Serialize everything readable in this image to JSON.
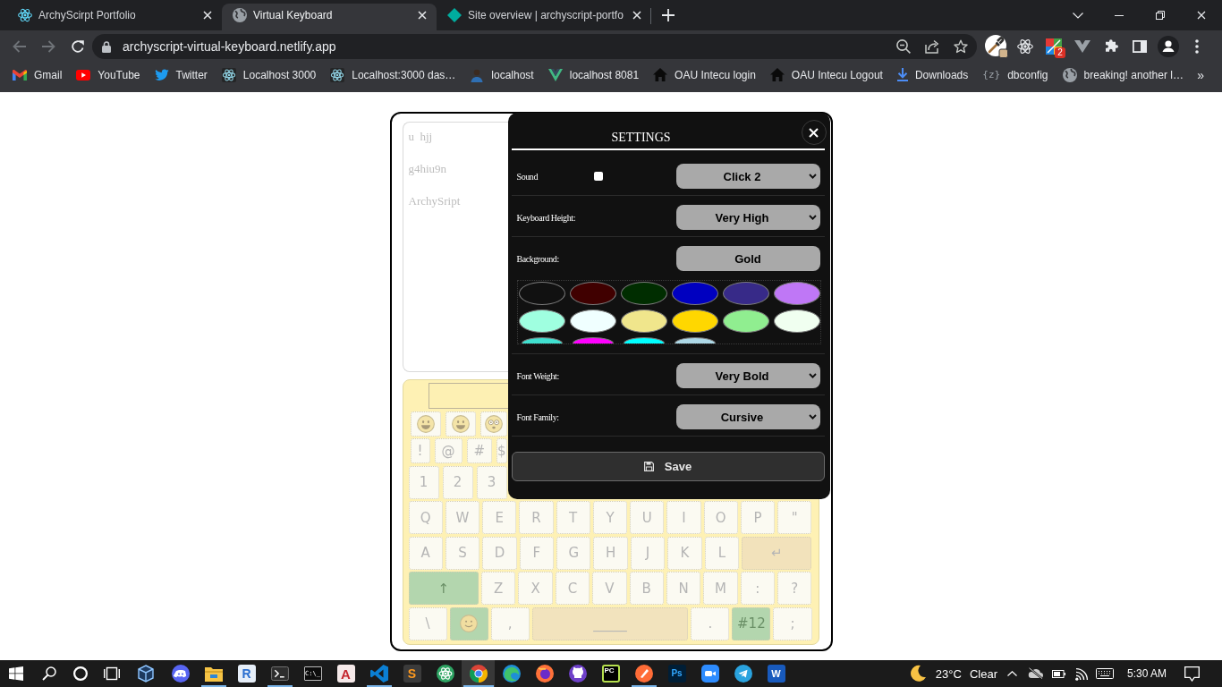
{
  "browser": {
    "tabs": [
      {
        "kind": "atom",
        "title": "ArchyScirpt Portfolio",
        "selected": false
      },
      {
        "kind": "globe",
        "title": "Virtual Keyboard",
        "selected": true
      },
      {
        "kind": "diamond",
        "title": "Site overview | archyscript-portfo",
        "selected": false
      }
    ],
    "nav": [
      {
        "kind": "back",
        "disabled": true
      },
      {
        "kind": "forward",
        "disabled": true
      },
      {
        "kind": "reload",
        "disabled": false
      }
    ],
    "url": "archyscript-virtual-keyboard.netlify.app",
    "extension_badge": "2",
    "bookmarks": [
      {
        "kind": "mail",
        "label": "Gmail"
      },
      {
        "kind": "play",
        "label": "YouTube"
      },
      {
        "kind": "bird",
        "label": "Twitter"
      },
      {
        "kind": "atom",
        "label": "Localhost 3000"
      },
      {
        "kind": "atom",
        "label": "Localhost:3000 das…"
      },
      {
        "kind": "avatar",
        "label": "localhost"
      },
      {
        "kind": "vee",
        "label": "localhost 8081"
      },
      {
        "kind": "home",
        "label": "OAU Intecu login"
      },
      {
        "kind": "home",
        "label": "OAU Intecu Logout"
      },
      {
        "kind": "download",
        "label": "Downloads"
      },
      {
        "kind": "glyph",
        "glyph": "{z}",
        "label": "dbconfig"
      },
      {
        "kind": "globe",
        "label": "breaking! another l…"
      }
    ],
    "bookmarks_more": "»"
  },
  "page": {
    "text_area": {
      "value": "u  hjj\n\ng4hiu9n\n\nArchySript"
    },
    "keyboard": {
      "rows": [
        {
          "kind": "emoji",
          "keys": [
            {
              "kind": "grin"
            },
            {
              "kind": "grin"
            },
            {
              "kind": "dizzy"
            }
          ]
        },
        {
          "kind": "symbol",
          "keys": [
            {
              "kind": "char",
              "label": "!"
            },
            {
              "kind": "char",
              "label": "@"
            },
            {
              "kind": "char",
              "label": "#"
            },
            {
              "kind": "char",
              "label": "$"
            }
          ]
        },
        {
          "kind": "number",
          "keys": [
            {
              "kind": "char",
              "label": "1"
            },
            {
              "kind": "char",
              "label": "2"
            },
            {
              "kind": "char",
              "label": "3"
            }
          ]
        },
        {
          "kind": "letter",
          "keys": [
            {
              "kind": "char",
              "label": "Q"
            },
            {
              "kind": "char",
              "label": "W"
            },
            {
              "kind": "char",
              "label": "E"
            },
            {
              "kind": "char",
              "label": "R"
            },
            {
              "kind": "char",
              "label": "T"
            },
            {
              "kind": "char",
              "label": "Y"
            },
            {
              "kind": "char",
              "label": "U"
            },
            {
              "kind": "char",
              "label": "I"
            },
            {
              "kind": "char",
              "label": "O"
            },
            {
              "kind": "char",
              "label": "P"
            },
            {
              "kind": "char",
              "label": "\""
            }
          ]
        },
        {
          "kind": "letter",
          "keys": [
            {
              "kind": "char",
              "label": "A"
            },
            {
              "kind": "char",
              "label": "S"
            },
            {
              "kind": "char",
              "label": "D"
            },
            {
              "kind": "char",
              "label": "F"
            },
            {
              "kind": "char",
              "label": "G"
            },
            {
              "kind": "char",
              "label": "H"
            },
            {
              "kind": "char",
              "label": "J"
            },
            {
              "kind": "char",
              "label": "K"
            },
            {
              "kind": "char",
              "label": "L"
            },
            {
              "kind": "enter",
              "label": "↵"
            }
          ]
        },
        {
          "kind": "letter",
          "keys": [
            {
              "kind": "shift",
              "label": "↑"
            },
            {
              "kind": "char",
              "label": "Z"
            },
            {
              "kind": "char",
              "label": "X"
            },
            {
              "kind": "char",
              "label": "C"
            },
            {
              "kind": "char",
              "label": "V"
            },
            {
              "kind": "char",
              "label": "B"
            },
            {
              "kind": "char",
              "label": "N"
            },
            {
              "kind": "char",
              "label": "M"
            },
            {
              "kind": "char",
              "label": ":"
            },
            {
              "kind": "char",
              "label": "?"
            }
          ]
        },
        {
          "kind": "bottom",
          "keys": [
            {
              "kind": "char",
              "label": "\\"
            },
            {
              "kind": "smile"
            },
            {
              "kind": "char",
              "label": ","
            },
            {
              "kind": "space",
              "label": "_____"
            },
            {
              "kind": "char",
              "label": "."
            },
            {
              "kind": "mode",
              "label": "#12"
            },
            {
              "kind": "char",
              "label": ";"
            }
          ]
        }
      ]
    },
    "settings": {
      "title": "SETTINGS",
      "rows": [
        {
          "kind": "check",
          "label": "Sound",
          "checked": false,
          "value": "Click 2"
        },
        {
          "kind": "select",
          "label": "Keyboard Height:",
          "value": "Very High"
        },
        {
          "kind": "palette",
          "label": "Background:",
          "value": "Gold",
          "swatches": [
            {
              "color": "#111111"
            },
            {
              "color": "#400000"
            },
            {
              "color": "#002d00"
            },
            {
              "color": "#0000c0"
            },
            {
              "color": "#372a88"
            },
            {
              "color": "#bf77f6"
            },
            {
              "color": "#9fffe0"
            },
            {
              "color": "#f0ffff"
            },
            {
              "color": "#f0e68c"
            },
            {
              "color": "#ffd700"
            },
            {
              "color": "#90ee90"
            },
            {
              "color": "#f0fff0"
            },
            {
              "color": "#40e0d0"
            },
            {
              "color": "#ff00ff"
            },
            {
              "color": "#00ffff"
            },
            {
              "color": "#add8e6"
            }
          ]
        },
        {
          "kind": "select",
          "label": "Font Weight:",
          "value": "Very Bold"
        },
        {
          "kind": "select",
          "label": "Font Family:",
          "value": "Cursive"
        }
      ],
      "save": "Save"
    }
  },
  "taskbar": {
    "apps": [
      {
        "kind": "start",
        "running": false,
        "selected": false
      },
      {
        "kind": "search",
        "running": false,
        "selected": false
      },
      {
        "kind": "ring",
        "running": false,
        "selected": false
      },
      {
        "kind": "taskview",
        "running": false,
        "selected": false
      },
      {
        "kind": "cube",
        "running": false,
        "selected": false
      },
      {
        "kind": "chat",
        "running": false,
        "selected": false
      },
      {
        "kind": "folder",
        "running": true,
        "selected": false
      },
      {
        "kind": "rlogo",
        "text": "R",
        "running": false,
        "selected": false
      },
      {
        "kind": "terminal",
        "running": true,
        "selected": false
      },
      {
        "kind": "console",
        "text": "C:\\_",
        "running": false,
        "selected": false
      },
      {
        "kind": "alogo",
        "text": "A",
        "running": false,
        "selected": false
      },
      {
        "kind": "ribbon",
        "running": true,
        "selected": false
      },
      {
        "kind": "slogo",
        "text": "S",
        "running": false,
        "selected": false
      },
      {
        "kind": "atom",
        "running": false,
        "selected": false
      },
      {
        "kind": "chrome",
        "running": true,
        "selected": true
      },
      {
        "kind": "edge",
        "running": false,
        "selected": false
      },
      {
        "kind": "firefox",
        "running": false,
        "selected": false
      },
      {
        "kind": "cat",
        "running": false,
        "selected": false
      },
      {
        "kind": "pclogo",
        "text": "PC",
        "running": false,
        "selected": false
      },
      {
        "kind": "pen",
        "running": true,
        "selected": false
      },
      {
        "kind": "pslogo",
        "text": "Ps",
        "running": false,
        "selected": false
      },
      {
        "kind": "camera",
        "running": false,
        "selected": false
      },
      {
        "kind": "plane",
        "running": false,
        "selected": false
      },
      {
        "kind": "wlogo",
        "text": "W",
        "running": false,
        "selected": false
      }
    ],
    "temperature": "23°C",
    "condition": "Clear",
    "clock": "5:30 AM"
  }
}
